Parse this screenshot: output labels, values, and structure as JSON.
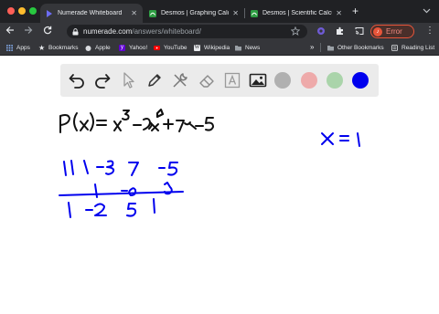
{
  "window": {
    "tabs": [
      {
        "title": "Numerade Whiteboard",
        "favicon": "numerade-play-icon",
        "color": "#6c6cf2",
        "active": true
      },
      {
        "title": "Desmos | Graphing Calculat",
        "favicon": "desmos-icon",
        "color": "#2f9e44",
        "active": false
      },
      {
        "title": "Desmos | Scientific Calcula",
        "favicon": "desmos-icon",
        "color": "#2f9e44",
        "active": false
      }
    ],
    "new_tab_icon": "plus-icon"
  },
  "toolbar": {
    "url_host": "numerade.com",
    "url_path": "/answers/whiteboard/",
    "error_label": "Error",
    "error_color": "#e8553a",
    "avatar_letter": "♪"
  },
  "bookmarks": {
    "items": [
      {
        "label": "Apps",
        "icon": "apps-grid-icon"
      },
      {
        "label": "Bookmarks",
        "icon": "star-icon"
      },
      {
        "label": "Apple",
        "icon": "apple-icon"
      },
      {
        "label": "Yahoo!",
        "icon": "yahoo-icon"
      },
      {
        "label": "YouTube",
        "icon": "youtube-icon"
      },
      {
        "label": "Wikipedia",
        "icon": "wikipedia-icon"
      },
      {
        "label": "News",
        "icon": "folder-icon"
      }
    ],
    "other_label": "Other Bookmarks",
    "reading_label": "Reading List"
  },
  "whiteboard": {
    "tools": [
      "undo",
      "redo",
      "select",
      "pen",
      "tools",
      "eraser",
      "text",
      "image"
    ],
    "colors": [
      "#b0b0b0",
      "#eeaaaa",
      "#aad4aa",
      "#0000ee"
    ],
    "selected_color": "#0000ee"
  }
}
